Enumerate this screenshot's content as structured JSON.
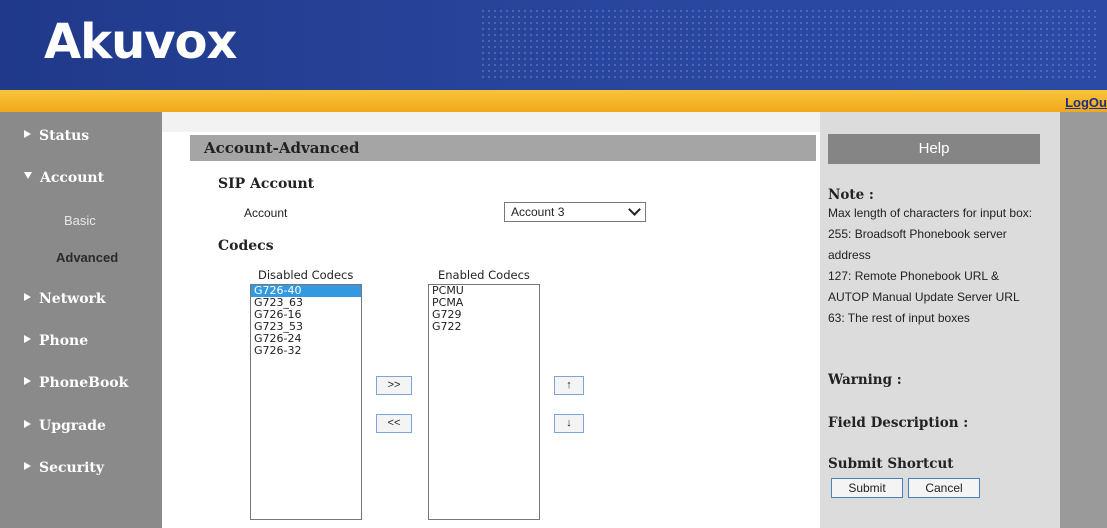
{
  "brand": {
    "logo": "Akuvox"
  },
  "header": {
    "logout": "LogOu"
  },
  "sidebar": {
    "items": [
      {
        "label": "Status",
        "expanded": false
      },
      {
        "label": "Account",
        "expanded": true
      },
      {
        "label": "Network",
        "expanded": false
      },
      {
        "label": "Phone",
        "expanded": false
      },
      {
        "label": "PhoneBook",
        "expanded": false
      },
      {
        "label": "Upgrade",
        "expanded": false
      },
      {
        "label": "Security",
        "expanded": false
      }
    ],
    "account_sub": [
      {
        "label": "Basic",
        "active": false
      },
      {
        "label": "Advanced",
        "active": true
      }
    ]
  },
  "main": {
    "title": "Account-Advanced",
    "sip_section": "SIP Account",
    "account_label": "Account",
    "account_value": "Account 3",
    "codecs_section": "Codecs",
    "disabled_caption": "Disabled Codecs",
    "enabled_caption": "Enabled Codecs",
    "disabled_codecs": [
      "G726-40",
      "G723_63",
      "G726-16",
      "G723_53",
      "G726-24",
      "G726-32"
    ],
    "disabled_selected": "G726-40",
    "enabled_codecs": [
      "PCMU",
      "PCMA",
      "G729",
      "G722"
    ],
    "btn_enable": ">>",
    "btn_disable": "<<",
    "btn_up": "↑",
    "btn_down": "↓"
  },
  "help": {
    "title": "Help",
    "note_heading": "Note :",
    "note_lines": [
      "Max length of characters for input box:",
      "255: Broadsoft Phonebook server address",
      "127: Remote Phonebook URL & AUTOP Manual Update Server URL",
      "63: The rest of input boxes"
    ],
    "warning_heading": "Warning :",
    "field_heading": "Field Description :",
    "shortcut_heading": "Submit Shortcut",
    "submit": "Submit",
    "cancel": "Cancel"
  },
  "colors": {
    "header_blue": "#233d8f",
    "orange_bar": "#f2a81a",
    "sidebar_gray": "#8a8a8a",
    "selection_blue": "#3399e0"
  }
}
